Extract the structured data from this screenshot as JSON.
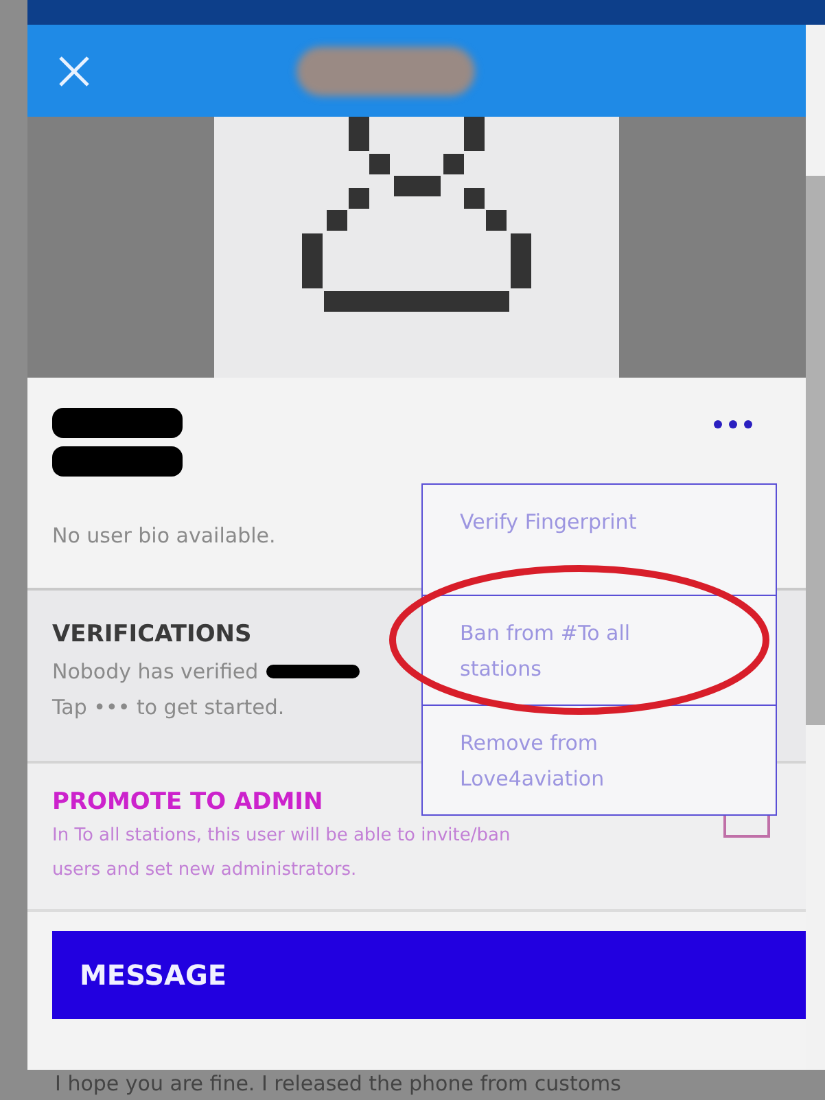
{
  "profile": {
    "bio": "No user bio available."
  },
  "verifications": {
    "title": "VERIFICATIONS",
    "lines": [
      "Nobody has verified",
      "Tap ••• to get started."
    ]
  },
  "admin": {
    "title": "PROMOTE TO ADMIN",
    "description": "In To all stations, this user will be able to invite/ban users and set new administrators.",
    "checked": false
  },
  "menu": {
    "items": [
      {
        "label": "Verify Fingerprint",
        "circled": false
      },
      {
        "label": "Ban from #To all stations",
        "circled": true
      },
      {
        "label": "Remove from Love4aviation",
        "circled": false
      }
    ]
  },
  "button": "MESSAGE",
  "background_text": "I hope you are fine. I released the phone from customs"
}
